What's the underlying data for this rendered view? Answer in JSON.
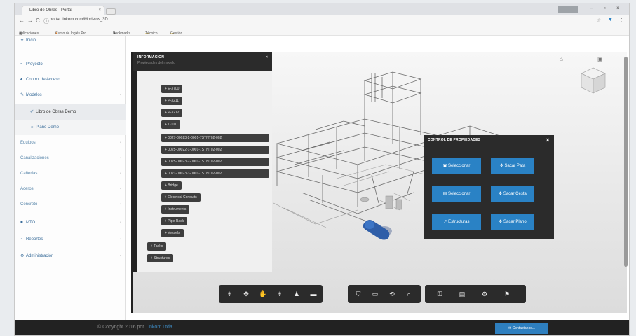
{
  "browser": {
    "tab_title": "Libro de Obras - Portal",
    "tab_close": "×",
    "window_controls": [
      "–",
      "▫",
      "×"
    ],
    "url": "portal.tinkom.com/Modelos_3D",
    "nav": [
      "←",
      "→",
      "C",
      "ⓘ"
    ],
    "bookmarks": [
      "Aplicaciones",
      "Curso de Inglés Pro",
      "Bookmarks",
      "Técnico",
      "Gestión"
    ]
  },
  "sidebar": {
    "items": [
      {
        "label": "Inicio",
        "icon": "✦"
      },
      {
        "label": "Proyecto",
        "icon": "▪"
      },
      {
        "label": "Control de Acceso",
        "icon": "♠"
      },
      {
        "label": "Modelos",
        "icon": "✎",
        "arrow": "‹"
      },
      {
        "label": "Libro de Obras Demo",
        "icon": "✐"
      },
      {
        "label": "Plano Demo",
        "icon": "☼"
      },
      {
        "label": "Equipos",
        "arrow": "‹"
      },
      {
        "label": "Canalizaciones",
        "arrow": "‹"
      },
      {
        "label": "Cañerías",
        "arrow": "‹"
      },
      {
        "label": "Aceros",
        "arrow": "‹"
      },
      {
        "label": "Concreto",
        "arrow": "‹"
      },
      {
        "label": "MTO",
        "icon": "■",
        "arrow": "‹"
      },
      {
        "label": "Reportes",
        "icon": "◔",
        "arrow": "‹"
      },
      {
        "label": "Administración",
        "icon": "⚙",
        "arrow": "‹"
      }
    ]
  },
  "info_panel": {
    "title": "INFORMACIÓN",
    "close": "×",
    "subtitle": "Propiedades del modelo",
    "nodes": [
      "+ E-3700",
      "+ P-3211",
      "+ P-3212",
      "+ T-101",
      "+ 0027-00023-2-0001-7STNT02-002",
      "+ 0025-00022-1-0001-7STNT02-002",
      "+ 0025-00023-2-0001-7STNT02-002",
      "+ 0021-00023-3-0001-7STNT02-002",
      "+ Bridge",
      "+ Electrical Conduits",
      "+ Instruments",
      "+ Pipe Rack",
      "+ Vessels",
      "+ Tanks",
      "+ Structures"
    ]
  },
  "control_panel": {
    "title": "CONTROL DE PROPIEDADES",
    "close": "×",
    "buttons": [
      {
        "label": "Seleccionar",
        "icon": "▣"
      },
      {
        "label": "Sacar Pata",
        "icon": "✥"
      },
      {
        "label": "Seleccionar",
        "icon": "▤"
      },
      {
        "label": "Sacar Cesta",
        "icon": "✥"
      },
      {
        "label": "Estructuras",
        "icon": "↗"
      },
      {
        "label": "Sacar Plano",
        "icon": "✥"
      }
    ]
  },
  "toolbar": {
    "groups": [
      [
        "⇟",
        "✥",
        "✋",
        "⇟",
        "♟",
        "▬"
      ],
      [
        "⛉",
        "▭",
        "⟲",
        "⌕"
      ],
      [
        "⚿",
        "▤",
        "⚙",
        "⚑"
      ]
    ]
  },
  "footer": {
    "copyright": "© Copyright 2016 por",
    "company": "Tinkom Ltda",
    "contact_button": "Contactanos..."
  },
  "colors": {
    "accent": "#2a82c5",
    "panel": "#2b2b2b",
    "footer": "#222222",
    "vessel": "#2f5ea8"
  }
}
